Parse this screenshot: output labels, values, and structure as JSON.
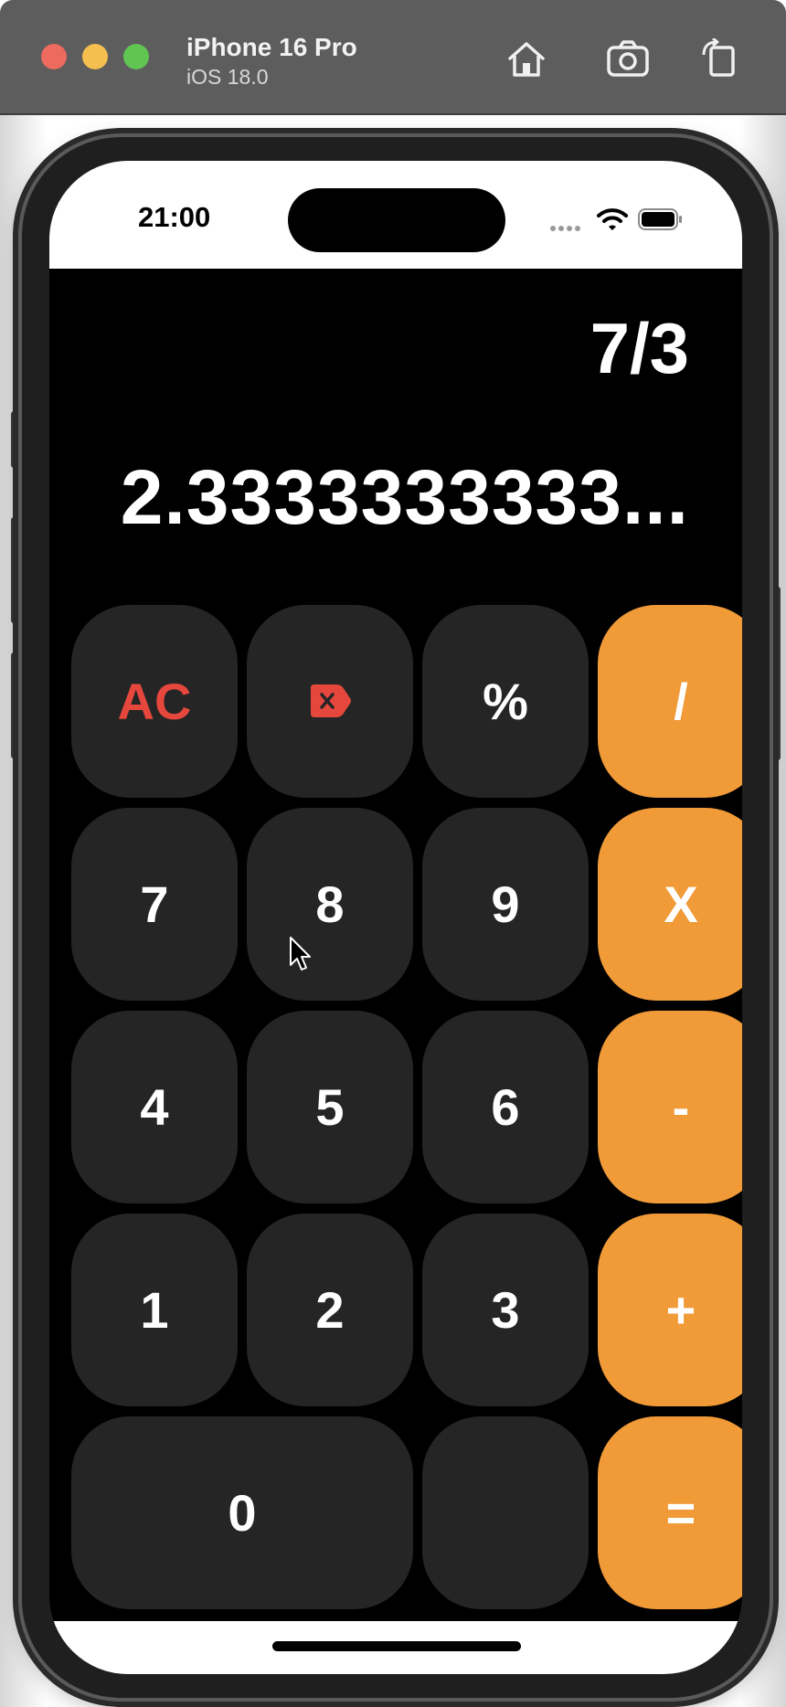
{
  "window": {
    "device_name": "iPhone 16 Pro",
    "os_version": "iOS 18.0",
    "toolbar_icons": [
      "home-icon",
      "screenshot-icon",
      "rotate-icon"
    ]
  },
  "status_bar": {
    "time": "21:00",
    "icons": [
      "cellular-icon",
      "wifi-icon",
      "battery-icon"
    ]
  },
  "display": {
    "expression": "7/3",
    "result": "2.3333333333..."
  },
  "keypad": {
    "rows": [
      [
        {
          "label": "AC",
          "style": "red"
        },
        {
          "label": "",
          "icon": "backspace-icon",
          "style": "red"
        },
        {
          "label": "%"
        },
        {
          "label": "/",
          "style": "operator"
        }
      ],
      [
        {
          "label": "7"
        },
        {
          "label": "8"
        },
        {
          "label": "9"
        },
        {
          "label": "X",
          "style": "operator"
        }
      ],
      [
        {
          "label": "4"
        },
        {
          "label": "5"
        },
        {
          "label": "6"
        },
        {
          "label": "-",
          "style": "operator"
        }
      ],
      [
        {
          "label": "1"
        },
        {
          "label": "2"
        },
        {
          "label": "3"
        },
        {
          "label": "+",
          "style": "operator"
        }
      ],
      [
        {
          "label": "0",
          "style": "wide"
        },
        {
          "label": ""
        },
        {
          "label": "=",
          "style": "operator"
        }
      ]
    ]
  },
  "colors": {
    "screen_background": "#000000",
    "key_background": "#252525",
    "operator_background": "#f09a38",
    "accent_red": "#e5473c",
    "text": "#ffffff"
  }
}
